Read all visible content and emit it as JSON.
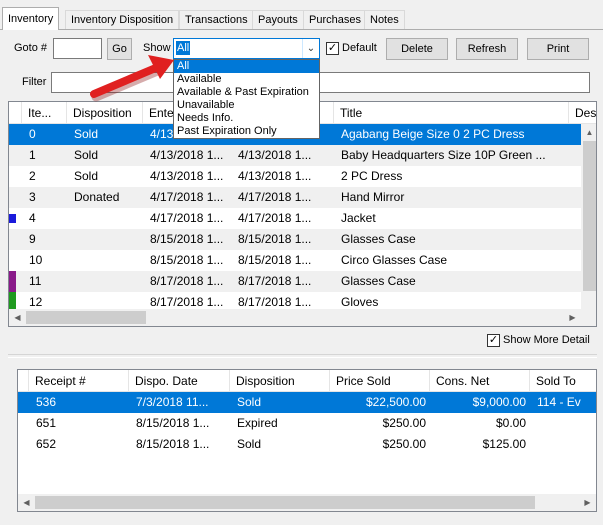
{
  "tabs": [
    "Inventory",
    "Inventory Disposition",
    "Transactions",
    "Payouts",
    "Purchases",
    "Notes"
  ],
  "toolbar": {
    "goto_label": "Goto #",
    "goto_value": "",
    "go_label": "Go",
    "show_label": "Show",
    "show_selected": "All",
    "default_label": "Default",
    "default_checked": "✓",
    "delete_label": "Delete",
    "refresh_label": "Refresh",
    "print_label": "Print",
    "filter_label": "Filter",
    "filter_value": ""
  },
  "show_options": [
    "All",
    "Available",
    "Available & Past Expiration",
    "Unavailable",
    "Needs Info.",
    "Past Expiration Only"
  ],
  "inventory": {
    "columns": [
      "Ite...",
      "Disposition",
      "Enters",
      "",
      "Title",
      "Des"
    ],
    "rows": [
      {
        "item": "0",
        "disposition": "Sold",
        "enters": "4/13/2018 1...",
        "date2": "4/13/2018 1...",
        "title": "Agabang Beige Size 0 2 PC Dress",
        "marker": ""
      },
      {
        "item": "1",
        "disposition": "Sold",
        "enters": "4/13/2018 1...",
        "date2": "4/13/2018 1...",
        "title": "Baby Headquarters Size 10P Green ...",
        "marker": ""
      },
      {
        "item": "2",
        "disposition": "Sold",
        "enters": "4/13/2018 1...",
        "date2": "4/13/2018 1...",
        "title": "2 PC Dress",
        "marker": ""
      },
      {
        "item": "3",
        "disposition": "Donated",
        "enters": "4/17/2018 1...",
        "date2": "4/17/2018 1...",
        "title": "Hand Mirror",
        "marker": ""
      },
      {
        "item": "4",
        "disposition": "",
        "enters": "4/17/2018 1...",
        "date2": "4/17/2018 1...",
        "title": "Jacket",
        "marker": "#1a1adb"
      },
      {
        "item": "9",
        "disposition": "",
        "enters": "8/15/2018 1...",
        "date2": "8/15/2018 1...",
        "title": "Glasses Case",
        "marker": ""
      },
      {
        "item": "10",
        "disposition": "",
        "enters": "8/15/2018 1...",
        "date2": "8/15/2018 1...",
        "title": "Circo Glasses Case",
        "marker": ""
      },
      {
        "item": "11",
        "disposition": "",
        "enters": "8/17/2018 1...",
        "date2": "8/17/2018 1...",
        "title": "Glasses Case",
        "marker": "#8a1a8a"
      },
      {
        "item": "12",
        "disposition": "",
        "enters": "8/17/2018 1...",
        "date2": "8/17/2018 1...",
        "title": "Gloves",
        "marker": "#1f9a1f"
      }
    ]
  },
  "show_more_detail_label": "Show More Detail",
  "show_more_detail_checked": "✓",
  "receipts": {
    "columns": [
      "Receipt #",
      "Dispo. Date",
      "Disposition",
      "Price Sold",
      "Cons. Net",
      "Sold To"
    ],
    "rows": [
      {
        "receipt": "536",
        "date": "7/3/2018 11...",
        "disposition": "Sold",
        "price": "$22,500.00",
        "net": "$9,000.00",
        "sold_to": "114 - Ev"
      },
      {
        "receipt": "651",
        "date": "8/15/2018 1...",
        "disposition": "Expired",
        "price": "$250.00",
        "net": "$0.00",
        "sold_to": ""
      },
      {
        "receipt": "652",
        "date": "8/15/2018 1...",
        "disposition": "Sold",
        "price": "$250.00",
        "net": "$125.00",
        "sold_to": ""
      }
    ]
  },
  "colors": {
    "selection": "#0078d7",
    "annotation_arrow": "#e02020"
  }
}
